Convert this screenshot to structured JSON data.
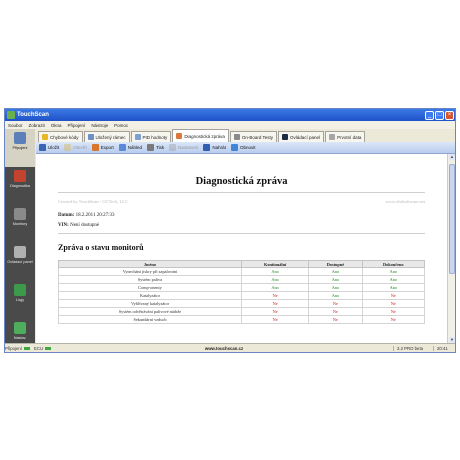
{
  "window": {
    "title": "TouchScan"
  },
  "menu": [
    "Soubor",
    "Zobrazit",
    "Okna",
    "Připojení",
    "Nástroje",
    "Pomoc"
  ],
  "sidebar": {
    "items": [
      {
        "label": "Připojení",
        "active": true,
        "icon": "plug-icon"
      },
      {
        "label": "Diagnostika",
        "active": false,
        "icon": "car-diagnostics-icon"
      },
      {
        "label": "Monitory",
        "active": false,
        "icon": "monitor-icon"
      },
      {
        "label": "Ovládací panel",
        "active": false,
        "icon": "dashboard-icon"
      },
      {
        "label": "Logy",
        "active": false,
        "icon": "log-icon"
      },
      {
        "label": "Nastav.",
        "active": false,
        "icon": "settings-icon"
      }
    ]
  },
  "tabs": [
    {
      "label": "Chybové kódy",
      "active": false
    },
    {
      "label": "Uložený rámec",
      "active": false
    },
    {
      "label": "PID hodnoty",
      "active": false
    },
    {
      "label": "Diagnostická zpráva",
      "active": true
    },
    {
      "label": "On-Board Testy",
      "active": false
    },
    {
      "label": "Ovládací panel",
      "active": false
    },
    {
      "label": "Prvotní data",
      "active": false
    }
  ],
  "toolbar": [
    {
      "label": "Uložit",
      "disabled": false,
      "icon": "save-icon"
    },
    {
      "label": "Otevřít",
      "disabled": true,
      "icon": "open-icon"
    },
    {
      "label": "Export",
      "disabled": false,
      "icon": "export-icon"
    },
    {
      "label": "Náhled",
      "disabled": false,
      "icon": "preview-icon"
    },
    {
      "label": "Tisk",
      "disabled": false,
      "icon": "print-icon"
    },
    {
      "label": "Nastavení",
      "disabled": true,
      "icon": "page-setup-icon"
    },
    {
      "label": "Nahrát",
      "disabled": false,
      "icon": "upload-icon"
    },
    {
      "label": "Obnovit",
      "disabled": false,
      "icon": "refresh-icon"
    }
  ],
  "report": {
    "title": "Diagnostická zpráva",
    "created_by": "Created by TouchScan - OCTech, LLC",
    "website": "www.obdsoftware.net",
    "date_label": "Datum:",
    "date_value": "18.2.2011 20:27:33",
    "vin_label": "VIN:",
    "vin_value": "Není dostupné",
    "section_title": "Zpráva o stavu monitorů",
    "columns": [
      "Jméno",
      "Kontinuální",
      "Dostupné",
      "Dokončeno"
    ],
    "rows": [
      [
        "Vynechání jiskry při zapalování",
        "Ano",
        "Ano",
        "Ano"
      ],
      [
        "Systém paliva",
        "Ano",
        "Ano",
        "Ano"
      ],
      [
        "Comp-onenty",
        "Ano",
        "Ano",
        "Ano"
      ],
      [
        "Katalyzátor",
        "Ne",
        "Ano",
        "Ne"
      ],
      [
        "Vyhřívaný katalyzátor",
        "Ne",
        "Ne",
        "Ne"
      ],
      [
        "Systém odvětrávání palivové nádrže",
        "Ne",
        "Ne",
        "Ne"
      ],
      [
        "Sekundární vzduch",
        "Ne",
        "Ne",
        "Ne"
      ]
    ]
  },
  "status": {
    "connection_label": "Připojení",
    "ecu_label": "ECU",
    "url": "www.touchscan.cz",
    "version": "3.2 PRO beta",
    "time": "20:41"
  },
  "colors": {
    "yes": "#178a17",
    "no": "#c21a1a",
    "titlebar": "#1e52c8",
    "sidebar": "#4a4a4a"
  }
}
